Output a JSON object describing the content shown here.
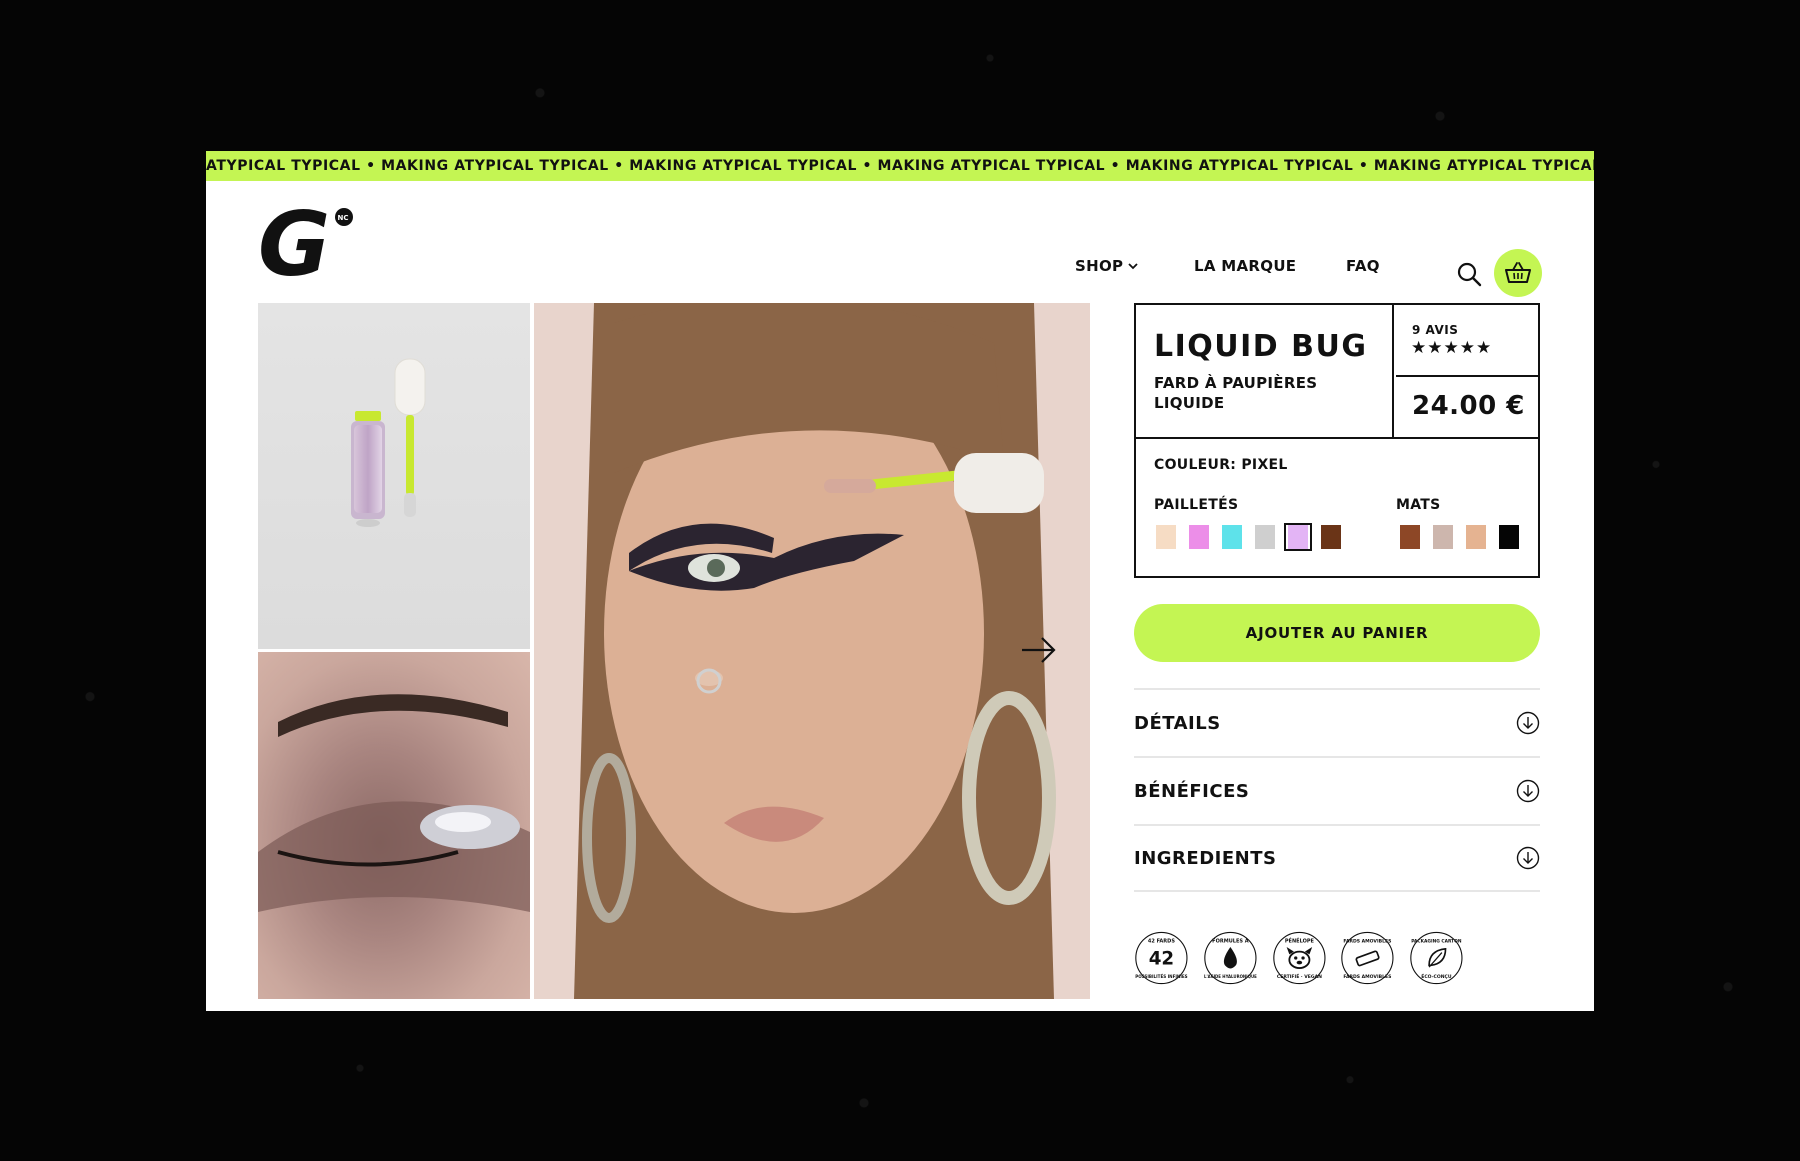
{
  "marquee": {
    "text": "ATYPICAL TYPICAL • MAKING ATYPICAL TYPICAL • MAKING ATYPICAL TYPICAL • MAKING ATYPICAL TYPICAL • MAKING ATYPICAL TYPICAL • MAKING ATYPICAL TYPICAL • MAKING A"
  },
  "header": {
    "logo_letter": "G",
    "logo_mark": "NC",
    "nav": {
      "shop": "SHOP",
      "brand": "LA MARQUE",
      "faq": "FAQ"
    }
  },
  "product": {
    "name": "LIQUID BUG",
    "subtitle": "FARD À PAUPIÈRES LIQUIDE",
    "reviews": "9 AVIS",
    "stars": "★★★★★",
    "price": "24.00 €",
    "color_prefix": "COULEUR:",
    "color_value": "PIXEL",
    "groups": {
      "glitter_label": "PAILLETÉS",
      "matte_label": "MATS"
    },
    "swatches_glitter": [
      "#f6dcc4",
      "#ec8ee8",
      "#5ee2ea",
      "#cfcfcf",
      "#e3b4f5",
      "#6a3417"
    ],
    "swatches_matte": [
      "#8d4726",
      "#cdb6ad",
      "#e5b391",
      "#050505"
    ],
    "selected_swatch": "#e3b4f5",
    "add_to_cart": "AJOUTER AU PANIER"
  },
  "accordion": {
    "details": "DÉTAILS",
    "benefits": "BÉNÉFICES",
    "ingredients": "INGREDIENTS"
  },
  "badges": {
    "b1_number": "42",
    "b1_top": "42 FARDS",
    "b1_bottom": "POSSIBILITÉS INFINIES",
    "b2_top": "FORMULES À",
    "b2_bottom": "L'ACIDE HYALURONIQUE",
    "b3_top": "PÉNÉLOPE",
    "b3_bottom": "CERTIFIÉ · VEGAN",
    "b4_top": "FARDS AMOVIBLES",
    "b4_bottom": "FARDS AMOVIBLES",
    "b5_top": "PACKAGING CARTON",
    "b5_bottom": "ÉCO-CONÇU"
  },
  "colors": {
    "accent": "#c4f553",
    "text": "#111111",
    "background": "#050505"
  }
}
